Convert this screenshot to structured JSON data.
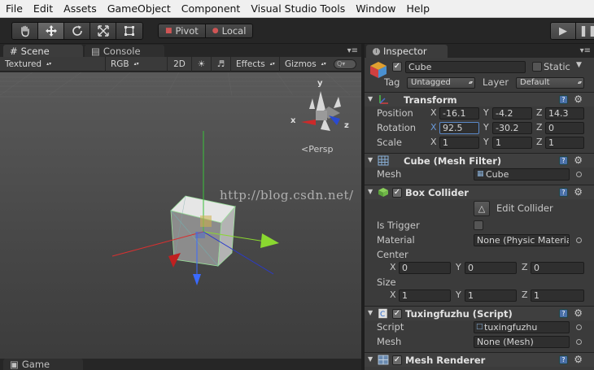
{
  "menu": [
    "File",
    "Edit",
    "Assets",
    "GameObject",
    "Component",
    "Visual Studio Tools",
    "Window",
    "Help"
  ],
  "toolbar": {
    "pivot": "Pivot",
    "local": "Local"
  },
  "scene": {
    "tabs": {
      "scene": "Scene",
      "console": "Console",
      "game": "Game"
    },
    "bar": {
      "shading": "Textured",
      "render_mode": "RGB",
      "mode_2d": "2D",
      "effects": "Effects",
      "gizmos": "Gizmos",
      "search_placeholder": "Q▾"
    },
    "persp": "Persp",
    "gizmo": {
      "x": "x",
      "y": "y",
      "z": "z"
    },
    "watermark": "http://blog.csdn.net/"
  },
  "inspector": {
    "tab": "Inspector",
    "object": {
      "name": "Cube",
      "static_label": "Static",
      "tag_label": "Tag",
      "tag_value": "Untagged",
      "layer_label": "Layer",
      "layer_value": "Default"
    },
    "transform": {
      "title": "Transform",
      "position": {
        "label": "Position",
        "x": "-16.1",
        "y": "-4.2",
        "z": "14.3"
      },
      "rotation": {
        "label": "Rotation",
        "x": "92.5",
        "y": "-30.2",
        "z": "0"
      },
      "scale": {
        "label": "Scale",
        "x": "1",
        "y": "1",
        "z": "1"
      }
    },
    "mesh_filter": {
      "title": "Cube (Mesh Filter)",
      "mesh_label": "Mesh",
      "mesh_value": "Cube"
    },
    "box_collider": {
      "title": "Box Collider",
      "edit_label": "Edit Collider",
      "is_trigger_label": "Is Trigger",
      "material_label": "Material",
      "material_value": "None (Physic Material)",
      "center_label": "Center",
      "center": {
        "x": "0",
        "y": "0",
        "z": "0"
      },
      "size_label": "Size",
      "size": {
        "x": "1",
        "y": "1",
        "z": "1"
      }
    },
    "script_comp": {
      "title": "Tuxingfuzhu (Script)",
      "script_label": "Script",
      "script_value": "tuxingfuzhu",
      "mesh_label": "Mesh",
      "mesh_value": "None (Mesh)"
    },
    "mesh_renderer": {
      "title": "Mesh Renderer"
    },
    "axis_labels": {
      "x": "X",
      "y": "Y",
      "z": "Z"
    }
  }
}
